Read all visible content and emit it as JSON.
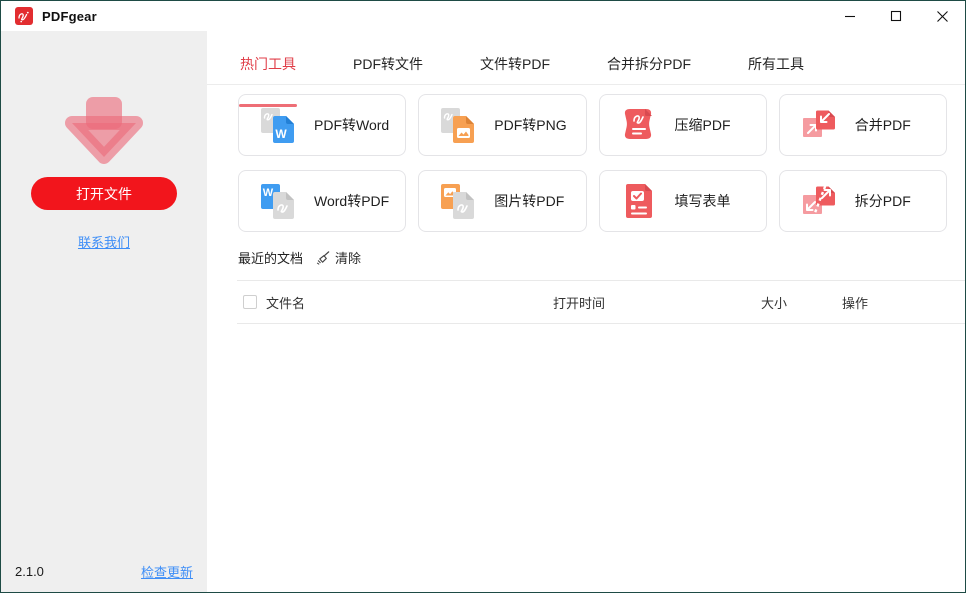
{
  "window": {
    "title": "PDFgear",
    "border_color": "#1e4b45"
  },
  "sidebar": {
    "open_button": "打开文件",
    "contact_link": "联系我们",
    "version": "2.1.0",
    "check_update_link": "检查更新",
    "accent_red": "#f2151c",
    "link_blue": "#3e8ef7"
  },
  "tabs": [
    {
      "label": "热门工具",
      "active": true
    },
    {
      "label": "PDF转文件",
      "active": false
    },
    {
      "label": "文件转PDF",
      "active": false
    },
    {
      "label": "合并拆分PDF",
      "active": false
    },
    {
      "label": "所有工具",
      "active": false
    }
  ],
  "tab_colors": {
    "active_text": "#e03e48",
    "underline": "#ee6e76"
  },
  "tools": [
    {
      "label": "PDF转Word",
      "icon": "pdf-to-word-icon"
    },
    {
      "label": "PDF转PNG",
      "icon": "pdf-to-png-icon"
    },
    {
      "label": "压缩PDF",
      "icon": "compress-pdf-icon"
    },
    {
      "label": "合并PDF",
      "icon": "merge-pdf-icon"
    },
    {
      "label": "Word转PDF",
      "icon": "word-to-pdf-icon"
    },
    {
      "label": "图片转PDF",
      "icon": "image-to-pdf-icon"
    },
    {
      "label": "填写表单",
      "icon": "fill-form-icon"
    },
    {
      "label": "拆分PDF",
      "icon": "split-pdf-icon"
    }
  ],
  "tool_colors": {
    "red": "#ee5b5e",
    "pink": "#f59ba0",
    "blue": "#3f9cf1",
    "orange": "#f7a052",
    "gray_doc": "#d9d9d9"
  },
  "recent": {
    "title": "最近的文档",
    "clear_label": "清除"
  },
  "table": {
    "headers": [
      "文件名",
      "打开时间",
      "大小",
      "操作"
    ],
    "rows": []
  }
}
